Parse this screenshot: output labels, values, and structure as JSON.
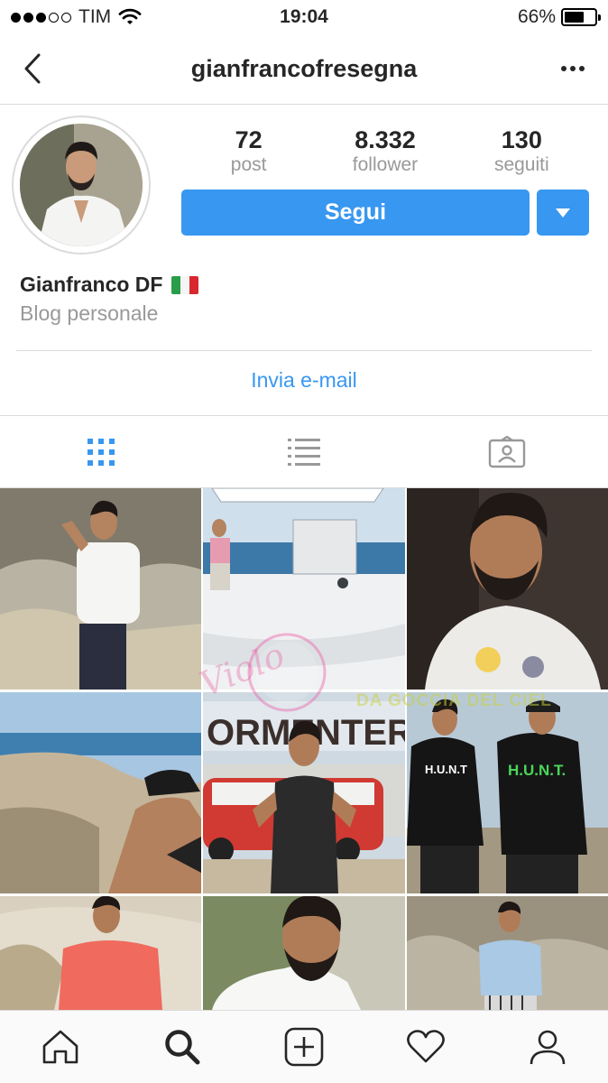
{
  "status_bar": {
    "carrier": "TIM",
    "time": "19:04",
    "battery": "66%",
    "battery_level": 0.66
  },
  "header": {
    "username": "gianfrancofresegna"
  },
  "profile": {
    "stats": [
      {
        "value": "72",
        "label": "post"
      },
      {
        "value": "8.332",
        "label": "follower"
      },
      {
        "value": "130",
        "label": "seguiti"
      }
    ],
    "follow_label": "Segui",
    "name": "Gianfranco DF",
    "bio": "Blog personale",
    "email_label": "Invia e-mail"
  },
  "tabs": [
    "grid-view-icon",
    "list-view-icon",
    "tagged-photos-icon"
  ],
  "grid": {
    "photos": [
      "photo-man-white-tshirt-cliffs",
      "photo-boat-interceptor",
      "photo-closeup-beard",
      "photo-beach-shore",
      "photo-formentera-van",
      "photo-two-men-hunt-tshirts",
      "photo-red-tshirt-dunes",
      "photo-white-shirt-closeup",
      "photo-blue-tshirt-rocks"
    ],
    "watermark_text": "Violo",
    "watermark_banner": "DA GOCCIA DEL CIEL"
  },
  "bottom_nav": [
    "home-icon",
    "search-icon",
    "add-post-icon",
    "activity-heart-icon",
    "profile-icon"
  ],
  "colors": {
    "accent": "#3897f0",
    "text": "#262626",
    "muted": "#999999",
    "border": "#dbdbdb"
  }
}
